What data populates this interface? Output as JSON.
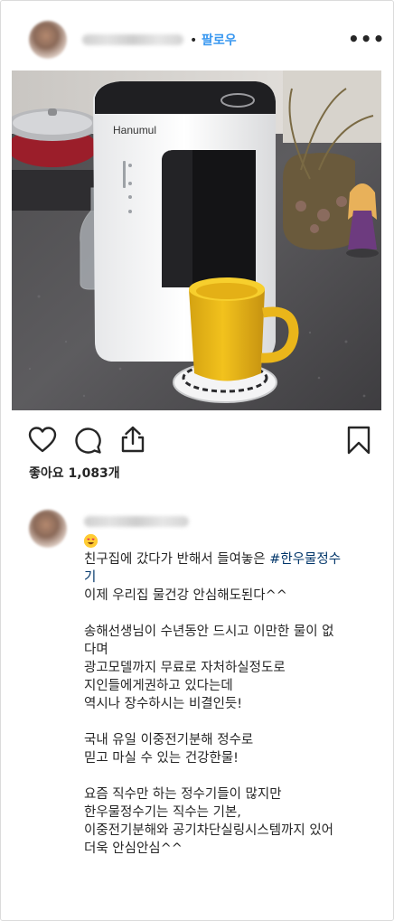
{
  "post": {
    "follow_label": "팔로우",
    "separator": "•",
    "more_label": "•••",
    "photo_brand": "Hanumul",
    "likes_text": "좋아요 1,083개",
    "colors": {
      "follow": "#3897f0",
      "hashtag": "#003569",
      "text": "#262626"
    },
    "icons": [
      "heart-icon",
      "comment-icon",
      "share-icon",
      "bookmark-icon",
      "heart-eyes-emoji-icon"
    ]
  },
  "caption": {
    "line_01_text": "친구집에 갔다가 반해서 들여놓은 ",
    "line_01_hashtag": "#한우물정수",
    "line_02_hashtag": "기",
    "line_03": "이제 우리집 물건강 안심해도된다^^",
    "line_05": "송해선생님이 수년동안 드시고 이만한 물이 없",
    "line_06": "다며",
    "line_07": "광고모델까지 무료로 자처하실정도로",
    "line_08": "지인들에게권하고 있다는데",
    "line_09": "역시나 장수하시는 비결인듯!",
    "line_11": "국내 유일 이중전기분해 정수로",
    "line_12": "믿고 마실 수 있는 건강한물!",
    "line_14": "요즘 직수만 하는 정수기들이 많지만",
    "line_15": "한우물정수기는 직수는 기본,",
    "line_16": "이중전기분해와 공기차단실링시스템까지 있어",
    "line_17": "더욱 안심안심^^"
  }
}
